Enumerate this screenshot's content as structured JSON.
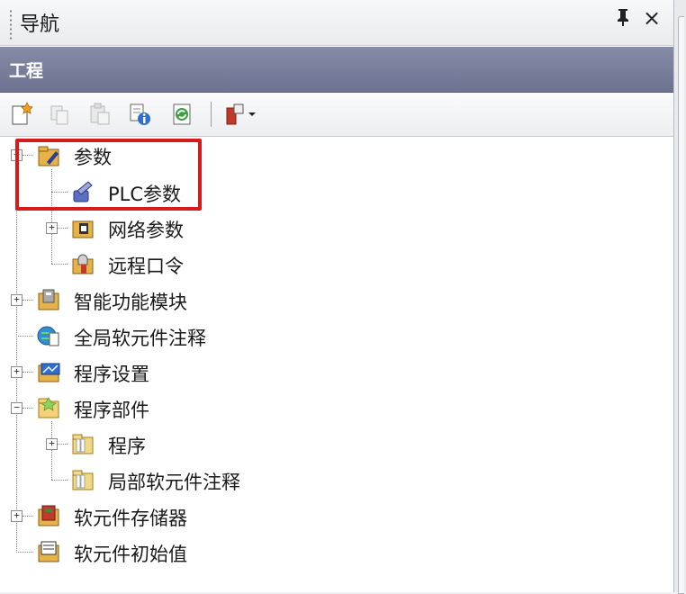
{
  "panel": {
    "title": "导航",
    "pin_glyph": "ᵽ",
    "close_glyph": "×",
    "section_label": "工程"
  },
  "toolbar": {
    "icons": [
      "new-item-icon",
      "copy-icon",
      "paste-icon",
      "properties-icon",
      "refresh-icon",
      "tool-dropdown-icon"
    ]
  },
  "tree": {
    "params": {
      "label": "参数",
      "expander": "+"
    },
    "plc_params": {
      "label": "PLC参数"
    },
    "network_params": {
      "label": "网络参数",
      "expander": "+"
    },
    "remote_password": {
      "label": "远程口令"
    },
    "intelligent_modules": {
      "label": "智能功能模块",
      "expander": "+"
    },
    "global_device_comment": {
      "label": "全局软元件注释"
    },
    "program_settings": {
      "label": "程序设置",
      "expander": "+"
    },
    "program_parts": {
      "label": "程序部件",
      "expander": "−"
    },
    "program": {
      "label": "程序",
      "expander": "+"
    },
    "local_device_comment": {
      "label": "局部软元件注释"
    },
    "device_memory": {
      "label": "软元件存储器",
      "expander": "+"
    },
    "device_initial_value": {
      "label": "软元件初始值"
    }
  },
  "colors": {
    "highlight_box": "#d71a1a",
    "section_header": "#767c98"
  }
}
